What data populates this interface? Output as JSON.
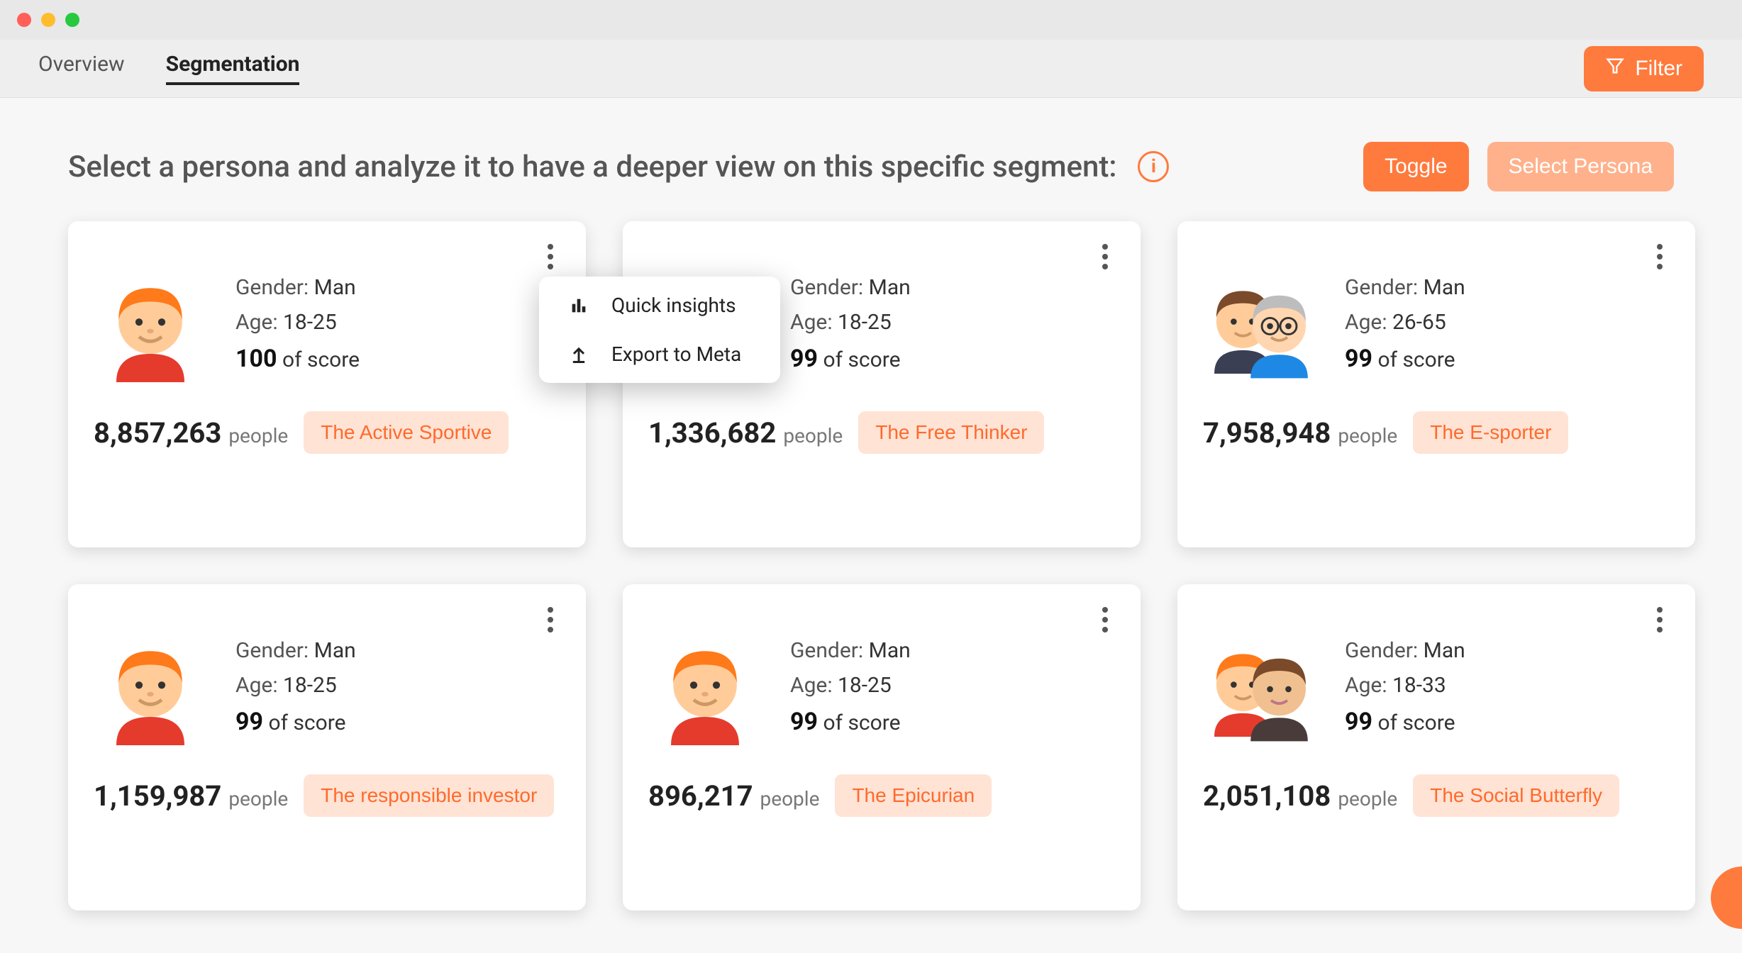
{
  "tabs": {
    "overview": "Overview",
    "segmentation": "Segmentation"
  },
  "filter_label": "Filter",
  "heading": "Select a persona and analyze it to have a deeper view on this specific segment:",
  "buttons": {
    "toggle": "Toggle",
    "select_persona": "Select Persona"
  },
  "labels": {
    "gender": "Gender:",
    "age": "Age:",
    "of_score": "of score",
    "people": "people"
  },
  "popover": {
    "quick_insights": "Quick insights",
    "export_to_meta": "Export to Meta"
  },
  "personas": [
    {
      "gender": "Man",
      "age": "18-25",
      "score": "100",
      "count": "8,857,263",
      "tag": "The Active Sportive",
      "avatar": "single_orange"
    },
    {
      "gender": "Man",
      "age": "18-25",
      "score": "99",
      "count": "1,336,682",
      "tag": "The Free Thinker",
      "avatar": "single_orange"
    },
    {
      "gender": "Man",
      "age": "26-65",
      "score": "99",
      "count": "7,958,948",
      "tag": "The E-sporter",
      "avatar": "pair_brown_grey"
    },
    {
      "gender": "Man",
      "age": "18-25",
      "score": "99",
      "count": "1,159,987",
      "tag": "The responsible investor",
      "avatar": "single_orange"
    },
    {
      "gender": "Man",
      "age": "18-25",
      "score": "99",
      "count": "896,217",
      "tag": "The Epicurian",
      "avatar": "single_orange"
    },
    {
      "gender": "Man",
      "age": "18-33",
      "score": "99",
      "count": "2,051,108",
      "tag": "The Social Butterfly",
      "avatar": "pair_orange_brown"
    }
  ]
}
